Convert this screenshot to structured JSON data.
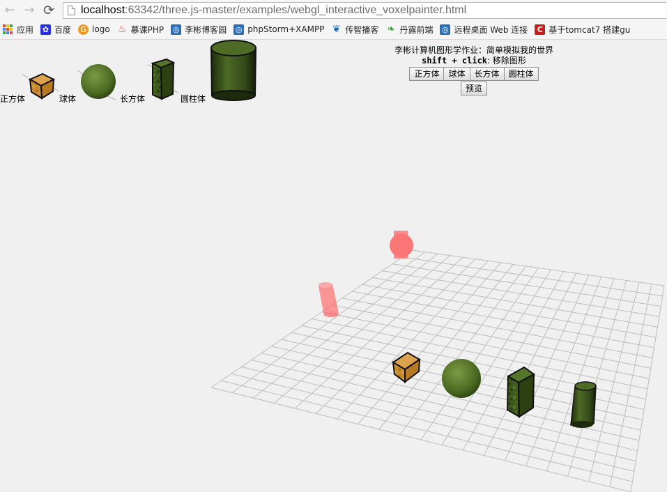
{
  "browser": {
    "url_host": "localhost",
    "url_path": ":63342/three.js-master/examples/webgl_interactive_voxelpainter.html",
    "bookmarks": [
      {
        "label": "应用",
        "icon": "apps-grid-icon"
      },
      {
        "label": "百度",
        "icon": "baidu-paw-icon",
        "color": "#2932e1"
      },
      {
        "label": "logo",
        "icon": "logo-g-icon",
        "color": "#f29a1e"
      },
      {
        "label": "慕课PHP",
        "icon": "flame-icon",
        "color": "#e8432d"
      },
      {
        "label": "李彬博客园",
        "icon": "cnblogs-icon",
        "color": "#2a6fbd"
      },
      {
        "label": "phpStorm+XAMPP",
        "icon": "cnblogs-icon",
        "color": "#2a6fbd"
      },
      {
        "label": "传智播客",
        "icon": "itcast-icon",
        "color": "#1a66b0"
      },
      {
        "label": "丹露前端",
        "icon": "leaf-icon",
        "color": "#3aa23a"
      },
      {
        "label": "远程桌面 Web 连接",
        "icon": "cnblogs-icon",
        "color": "#2a6fbd"
      },
      {
        "label": "基于tomcat7 搭建gu",
        "icon": "csdn-c-icon",
        "color": "#c81d1d"
      }
    ]
  },
  "palette": {
    "labels": [
      "正方体",
      "球体",
      "长方体",
      "圆柱体"
    ]
  },
  "info": {
    "title": "李彬计算机图形学作业：简单模拟我的世界",
    "hint_key": "shift + click",
    "hint_text": ": 移除图形",
    "buttons": [
      "正方体",
      "球体",
      "长方体",
      "圆柱体"
    ],
    "preview": "预览"
  },
  "colors": {
    "cube_orange": "#c88a2e",
    "moss_green": "#3e5a1e",
    "ghost_red": "#ff5555",
    "grid_line": "#bdbdbd"
  }
}
